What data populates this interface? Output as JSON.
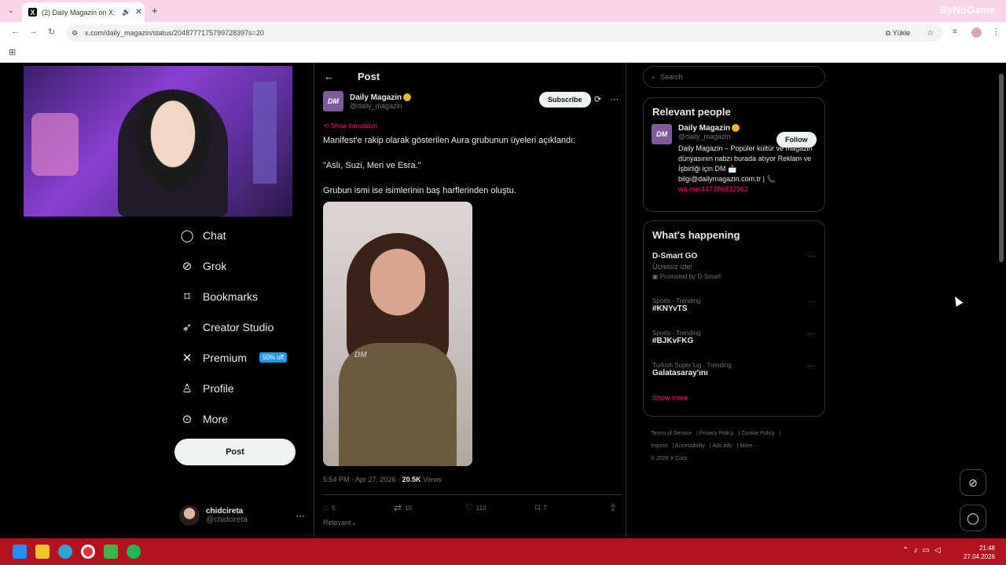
{
  "browser": {
    "tab_title": "(2) Daily Magazin on X: \"Ma",
    "url": "x.com/daily_magazin/status/2048777175799728397s=20",
    "yukle_label": "Yükle",
    "watermark": "ByNoGame"
  },
  "sidebar": {
    "items": [
      {
        "label": "Chat",
        "icon": "chat-icon"
      },
      {
        "label": "Grok",
        "icon": "grok-icon"
      },
      {
        "label": "Bookmarks",
        "icon": "bookmark-icon"
      },
      {
        "label": "Creator Studio",
        "icon": "rocket-icon"
      },
      {
        "label": "Premium",
        "icon": "x-logo-icon",
        "badge": "50% off"
      },
      {
        "label": "Profile",
        "icon": "person-icon"
      },
      {
        "label": "More",
        "icon": "more-circle-icon"
      }
    ],
    "post_button": "Post",
    "account": {
      "name": "chidcireta",
      "handle": "@chidcireta"
    }
  },
  "post": {
    "header_title": "Post",
    "author_name": "Daily Magazin",
    "author_handle": "@daily_magazin",
    "subscribe_label": "Subscribe",
    "show_translation": "Show translation",
    "paragraphs": [
      "Manifest'e rakip olarak gösterilen Aura grubunun üyeleri açıklandı:",
      "\"Aslı, Suzi, Meri ve Esra.\"",
      "Grubun ismi ise isimlerinin baş harflerinden oluştu."
    ],
    "video_watermark": "DM",
    "timestamp": "5:54 PM · Apr 27, 2026 · ",
    "views_count": "20.5K",
    "views_label": " Views",
    "replies": "5",
    "reposts": "10",
    "likes": "110",
    "bookmarks": "7",
    "sort_label": "Relevant"
  },
  "right": {
    "search_placeholder": "Search",
    "relevant_people_title": "Relevant people",
    "person": {
      "name": "Daily Magazin",
      "handle": "@daily_magazin",
      "follow_label": "Follow",
      "bio": "Daily Magazin – Popüler kültür ve magazin dünyasının nabzı burada atıyor Reklam ve İşbirliği için DM 📩 bilgi@dailymagazin.com.tr | 📞",
      "link": "wa.me/447386832962"
    },
    "happening_title": "What's happening",
    "trends": [
      {
        "category": "",
        "name": "D-Smart GO",
        "sub": "Ücretsiz izle!",
        "promo": "Promoted by D-Smart"
      },
      {
        "category": "Sports · Trending",
        "name": "#KNYvTS"
      },
      {
        "category": "Sports · Trending",
        "name": "#BJKvFKG"
      },
      {
        "category": "Turkish Super Lig · Trending",
        "name": "Galatasaray'ını"
      }
    ],
    "show_more": "Show more",
    "footer": [
      "Terms of Service",
      "Privacy Policy",
      "Cookie Policy",
      "Imprint",
      "Accessibility",
      "Ads info",
      "More ···",
      "© 2026 X Corp."
    ]
  },
  "taskbar": {
    "time": "21:48",
    "date": "27.04.2026"
  },
  "colors": {
    "accent_pink": "#f91880",
    "premium_blue": "#1d9bf0",
    "taskbar_red": "#b3121f"
  }
}
